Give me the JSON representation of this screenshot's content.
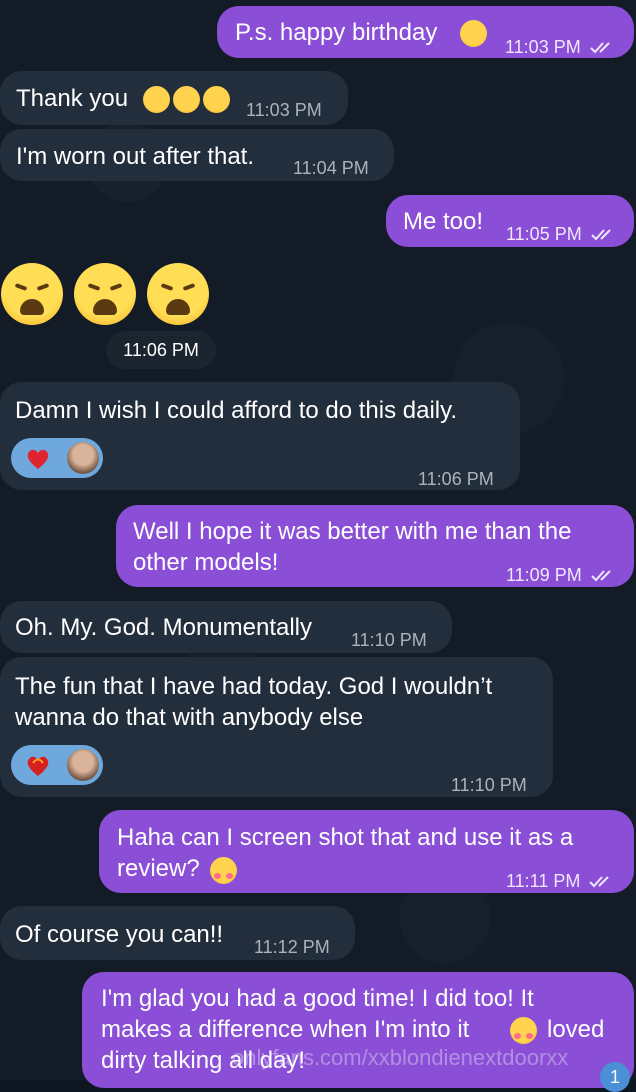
{
  "messages": [
    {
      "id": "m1",
      "direction": "out",
      "text": "P.s. happy birthday",
      "emoji": "smiling-face-icon",
      "time": "11:03 PM",
      "read": true
    },
    {
      "id": "m2",
      "direction": "in",
      "text": "Thank you",
      "emoji": "sleepy-face-icon x3",
      "time": "11:03 PM"
    },
    {
      "id": "m3",
      "direction": "in",
      "text": "I'm worn out after that.",
      "time": "11:04 PM"
    },
    {
      "id": "m4",
      "direction": "out",
      "text": "Me too!",
      "time": "11:05 PM",
      "read": true
    },
    {
      "id": "m5",
      "direction": "in",
      "type": "emoji",
      "emoji": "weary-face-icon x3",
      "time": "11:06 PM"
    },
    {
      "id": "m6",
      "direction": "in",
      "text": "Damn I wish I could afford to do this daily.",
      "reaction": "heart-icon",
      "time": "11:06 PM"
    },
    {
      "id": "m7",
      "direction": "out",
      "line1": "Well I hope it was better with me than the",
      "line2": "other models!",
      "time": "11:09 PM",
      "read": true
    },
    {
      "id": "m8",
      "direction": "in",
      "text": "Oh. My. God. Monumentally",
      "time": "11:10 PM"
    },
    {
      "id": "m9",
      "direction": "in",
      "line1": "The fun that I have had today. God I wouldn’t",
      "line2": "wanna do that with anybody else",
      "reaction": "heart-on-fire-icon",
      "time": "11:10 PM"
    },
    {
      "id": "m10",
      "direction": "out",
      "line1": "Haha can I screen shot that and use it as a",
      "line2": "review?",
      "emoji": "smiling-face-with-hearts-icon",
      "time": "11:11 PM",
      "read": true
    },
    {
      "id": "m11",
      "direction": "in",
      "text": "Of course you can!!",
      "time": "11:12 PM"
    },
    {
      "id": "m12",
      "direction": "out",
      "line1": "I'm glad you had a good time! I did too! It",
      "line2a": "makes a difference when I'm into it",
      "line2b": "loved",
      "line3": "dirty talking all day!",
      "emoji": "smiling-face-with-hearts-icon"
    }
  ],
  "watermark": "onlyfans.com/xxblondienextdoorxx",
  "unread_count": "1",
  "colors": {
    "incoming": "#232e3c",
    "outgoing": "#8a4fd6",
    "background": "#121b26",
    "reaction": "#6fa8dc"
  }
}
